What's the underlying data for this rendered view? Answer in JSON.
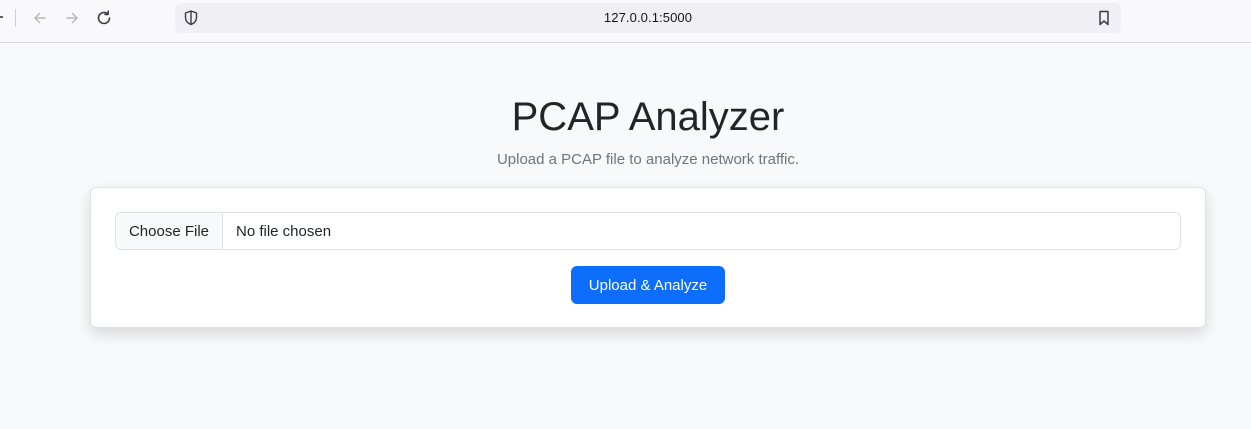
{
  "browser": {
    "url": "127.0.0.1:5000",
    "icons": {
      "back": "arrow-left-icon",
      "forward": "arrow-right-icon",
      "reload": "reload-icon",
      "tracking_protection": "shield-icon",
      "bookmark": "bookmark-icon"
    }
  },
  "page": {
    "title": "PCAP Analyzer",
    "subtitle": "Upload a PCAP file to analyze network traffic."
  },
  "form": {
    "choose_file_label": "Choose File",
    "file_status": "No file chosen",
    "submit_label": "Upload & Analyze"
  },
  "colors": {
    "primary": "#0d6efd",
    "page_background": "#f8f9fa",
    "heading_text": "#212529",
    "muted_text": "#6c757d"
  }
}
